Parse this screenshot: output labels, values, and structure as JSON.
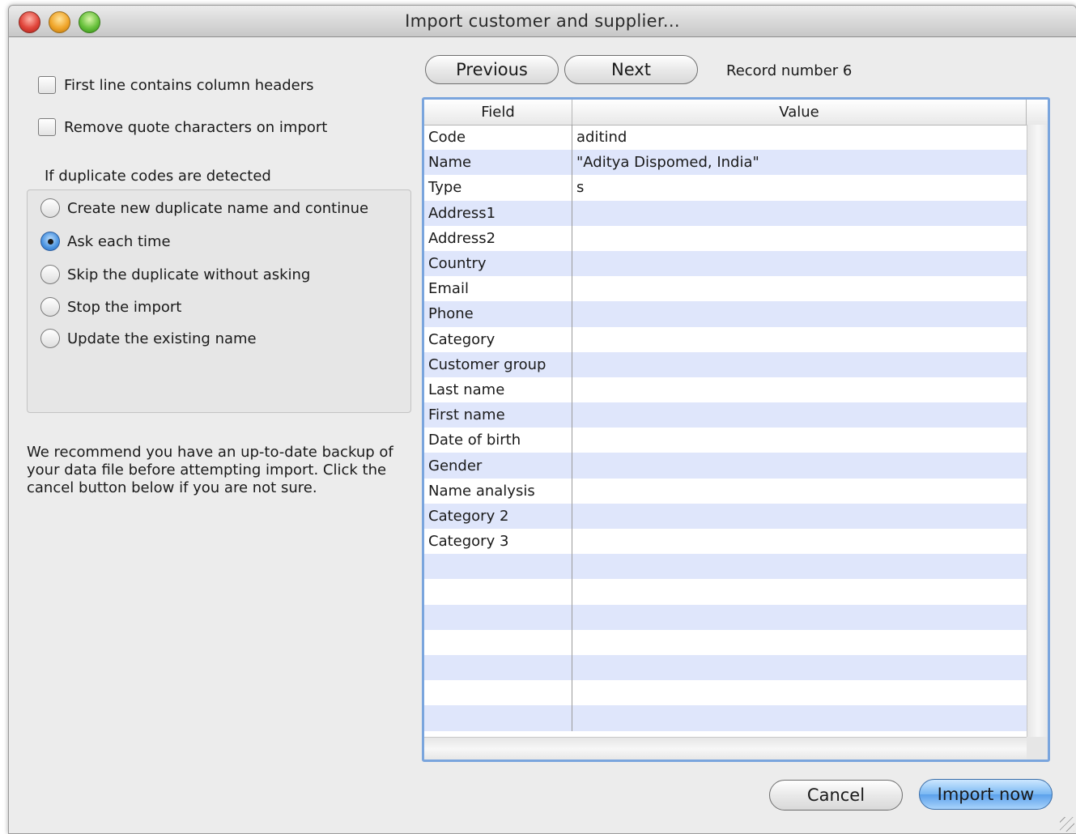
{
  "window": {
    "title": "Import customer and supplier..."
  },
  "options": {
    "first_line_headers": {
      "label": "First line contains column headers",
      "checked": false
    },
    "remove_quotes": {
      "label": "Remove quote characters on import",
      "checked": false
    }
  },
  "duplicates": {
    "heading": "If duplicate codes are detected",
    "choices": [
      {
        "label": "Create new duplicate name and continue",
        "selected": false
      },
      {
        "label": "Ask each time",
        "selected": true
      },
      {
        "label": "Skip the duplicate without asking",
        "selected": false
      },
      {
        "label": "Stop the import",
        "selected": false
      },
      {
        "label": "Update the existing name",
        "selected": false
      }
    ]
  },
  "notice": "We recommend you have an up-to-date backup of your data file before attempting import. Click the cancel button below if you are not sure.",
  "navigation": {
    "previous_label": "Previous",
    "next_label": "Next",
    "record_text": "Record number 6"
  },
  "table": {
    "columns": [
      "Field",
      "Value"
    ],
    "rows": [
      {
        "field": "Code",
        "value": "aditind"
      },
      {
        "field": "Name",
        "value": "\"Aditya Dispomed, India\""
      },
      {
        "field": "Type",
        "value": "s"
      },
      {
        "field": "Address1",
        "value": ""
      },
      {
        "field": "Address2",
        "value": ""
      },
      {
        "field": "Country",
        "value": ""
      },
      {
        "field": "Email",
        "value": ""
      },
      {
        "field": "Phone",
        "value": ""
      },
      {
        "field": "Category",
        "value": ""
      },
      {
        "field": "Customer group",
        "value": ""
      },
      {
        "field": "Last name",
        "value": ""
      },
      {
        "field": "First name",
        "value": ""
      },
      {
        "field": "Date of birth",
        "value": ""
      },
      {
        "field": "Gender",
        "value": ""
      },
      {
        "field": "Name analysis",
        "value": ""
      },
      {
        "field": "Category 2",
        "value": ""
      },
      {
        "field": "Category 3",
        "value": ""
      },
      {
        "field": "",
        "value": ""
      },
      {
        "field": "",
        "value": ""
      },
      {
        "field": "",
        "value": ""
      },
      {
        "field": "",
        "value": ""
      },
      {
        "field": "",
        "value": ""
      },
      {
        "field": "",
        "value": ""
      },
      {
        "field": "",
        "value": ""
      }
    ]
  },
  "actions": {
    "cancel_label": "Cancel",
    "import_label": "Import now"
  }
}
